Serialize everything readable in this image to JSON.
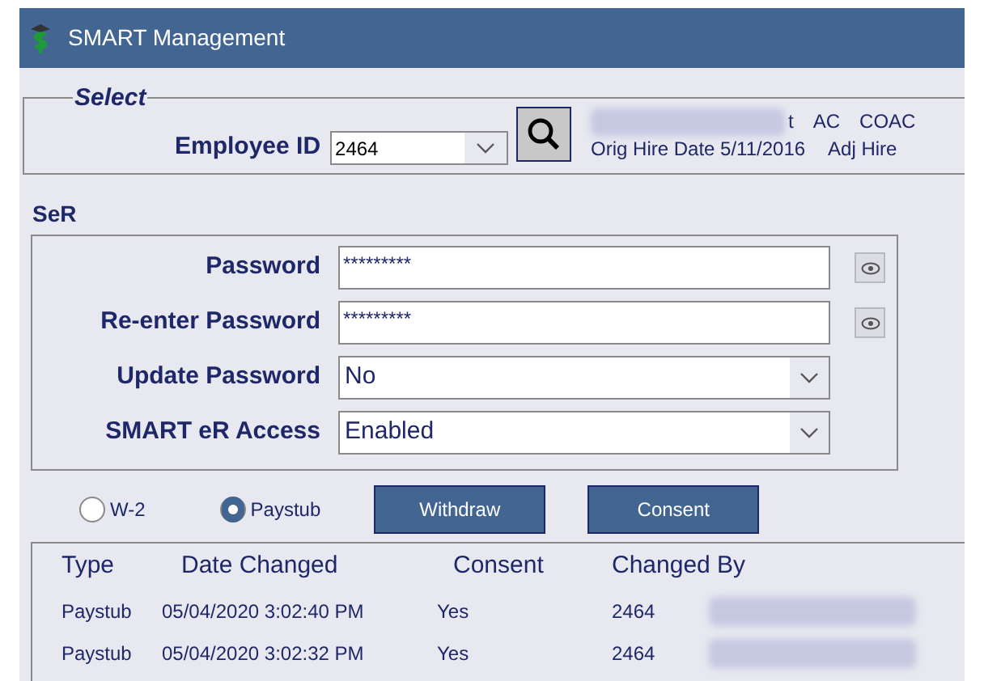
{
  "window": {
    "title": "SMART Management"
  },
  "select": {
    "legend": "Select",
    "employee_label": "Employee ID",
    "employee_id": "2464",
    "info_line_1": [
      "t",
      "AC",
      "COAC"
    ],
    "info_line_2": [
      "Orig Hire Date 5/11/2016",
      "Adj Hire"
    ]
  },
  "section_title": "SeR",
  "fields": [
    {
      "kind": "password",
      "label": "Password",
      "value": "*********"
    },
    {
      "kind": "password",
      "label": "Re-enter Password",
      "value": "*********"
    },
    {
      "kind": "dropdown",
      "label": "Update Password",
      "value": "No"
    },
    {
      "kind": "dropdown",
      "label": "SMART eR Access",
      "value": "Enabled"
    }
  ],
  "radios": [
    {
      "label": "W-2",
      "selected": false
    },
    {
      "label": "Paystub",
      "selected": true
    }
  ],
  "buttons": [
    "Withdraw",
    "Consent"
  ],
  "table": {
    "columns": [
      "Type",
      "Date Changed",
      "Consent",
      "Changed By"
    ],
    "rows": [
      [
        "Paystub",
        "05/04/2020 3:02:40 PM",
        "Yes",
        "2464"
      ],
      [
        "Paystub",
        "05/04/2020 3:02:32 PM",
        "Yes",
        "2464"
      ]
    ]
  }
}
